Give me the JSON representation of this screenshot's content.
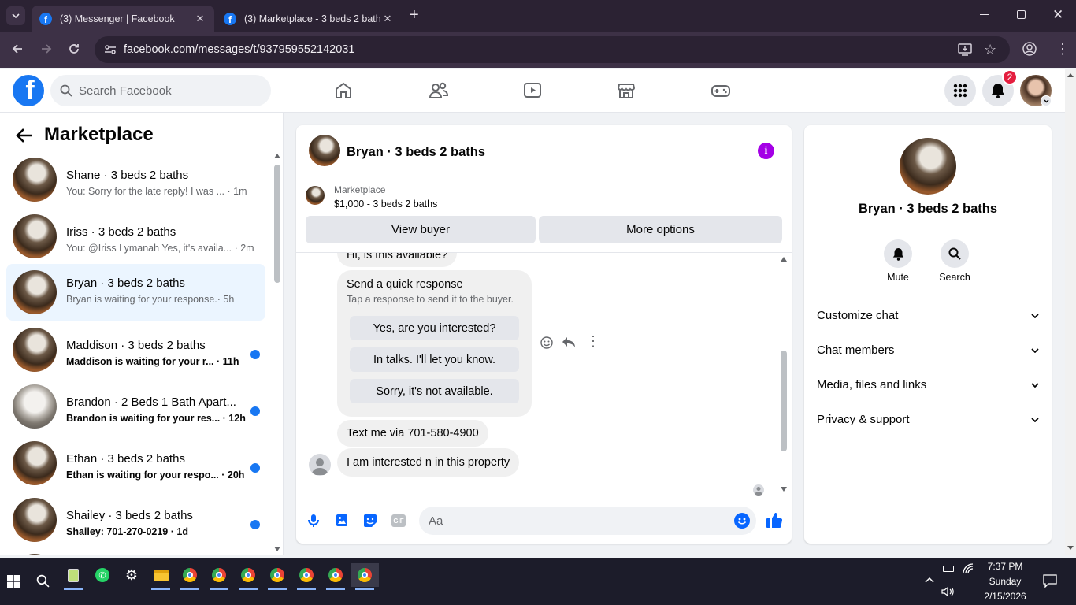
{
  "browser": {
    "tabs": [
      {
        "title": "(3) Messenger | Facebook",
        "active": true
      },
      {
        "title": "(3) Marketplace - 3 beds 2 bath",
        "active": false
      }
    ],
    "url": "facebook.com/messages/t/937959552142031"
  },
  "header": {
    "search_placeholder": "Search Facebook",
    "notification_count": "2",
    "brand_color": "#1877f2",
    "nav_icons": [
      "home-icon",
      "friends-icon",
      "watch-icon",
      "marketplace-icon",
      "gaming-icon"
    ]
  },
  "sidebar": {
    "title": "Marketplace",
    "conversations": [
      {
        "name": "Shane · 3 beds 2 baths",
        "preview": "You: Sorry for the late reply! I was ...",
        "time": "· 1m",
        "unread": false
      },
      {
        "name": "Iriss · 3 beds 2 baths",
        "preview": "You: @Iriss Lymanah Yes, it's availa...",
        "time": "· 2m",
        "unread": false
      },
      {
        "name": "Bryan · 3 beds 2 baths",
        "preview": "Bryan is waiting for your response.",
        "time": "· 5h",
        "unread": false,
        "selected": true
      },
      {
        "name": "Maddison · 3 beds 2 baths",
        "preview": "Maddison is waiting for your r...",
        "time": "· 11h",
        "unread": true
      },
      {
        "name": "Brandon · 2 Beds 1 Bath Apart...",
        "preview": "Brandon is waiting for your res...",
        "time": "· 12h",
        "unread": true
      },
      {
        "name": "Ethan · 3 beds 2 baths",
        "preview": "Ethan is waiting for your respo...",
        "time": "· 20h",
        "unread": true
      },
      {
        "name": "Shailey · 3 beds 2 baths",
        "preview": "Shailey: 701-270-0219",
        "time": "· 1d",
        "unread": true
      }
    ]
  },
  "chat": {
    "title": "Bryan · 3 beds 2 baths",
    "listing_label": "Marketplace",
    "listing": "$1,000 - 3 beds 2 baths",
    "view_buyer": "View buyer",
    "more_options": "More options",
    "messages": {
      "first": "Hi, is this available?",
      "quick_title": "Send a quick response",
      "quick_subtitle": "Tap a response to send it to the buyer.",
      "quick_replies": [
        "Yes, are you interested?",
        "In talks. I'll let you know.",
        "Sorry, it's not available."
      ],
      "phone": "Text me via 701-580-4900",
      "interest": "I am interested n in this property"
    },
    "input_placeholder": "Aa"
  },
  "info_panel": {
    "name": "Bryan · 3 beds 2 baths",
    "mute": "Mute",
    "search": "Search",
    "sections": [
      "Customize chat",
      "Chat members",
      "Media, files and links",
      "Privacy & support"
    ]
  },
  "taskbar": {
    "time": "7:37 PM",
    "day": "Sunday",
    "date": "2/15/2026"
  }
}
